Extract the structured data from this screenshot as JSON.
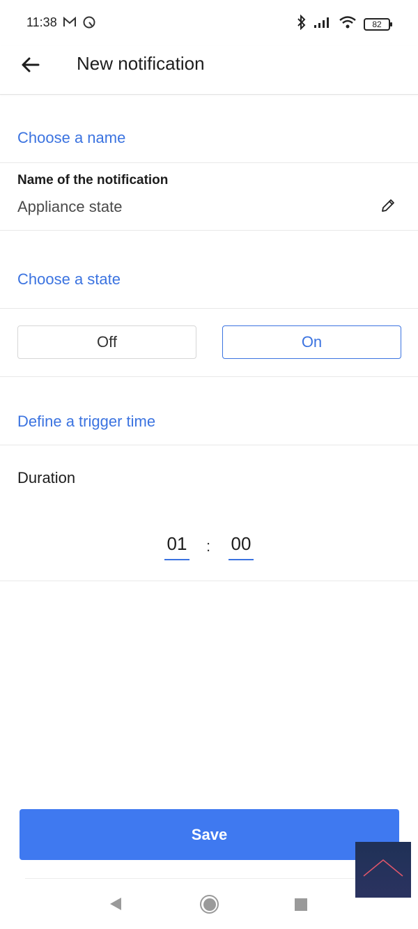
{
  "status_bar": {
    "time": "11:38",
    "battery": "82",
    "icons": [
      "gmail-icon",
      "sync-icon",
      "bluetooth-icon",
      "signal-icon",
      "wifi-icon",
      "battery-icon"
    ]
  },
  "app_bar": {
    "title": "New notification",
    "back_icon": "arrow-left-icon"
  },
  "sections": {
    "name_header": "Choose a name",
    "state_header": "Choose a state",
    "trigger_header": "Define a trigger time"
  },
  "name_field": {
    "label": "Name of the notification",
    "value": "Appliance state",
    "edit_icon": "pencil-icon"
  },
  "state_toggle": {
    "off_label": "Off",
    "on_label": "On",
    "selected": "On"
  },
  "duration": {
    "label": "Duration",
    "hours": "01",
    "separator": ":",
    "minutes": "00"
  },
  "save_label": "Save",
  "colors": {
    "accent": "#3b73e0",
    "save_button": "#3f79f0",
    "scroll_top_bg": "#1f3157"
  }
}
